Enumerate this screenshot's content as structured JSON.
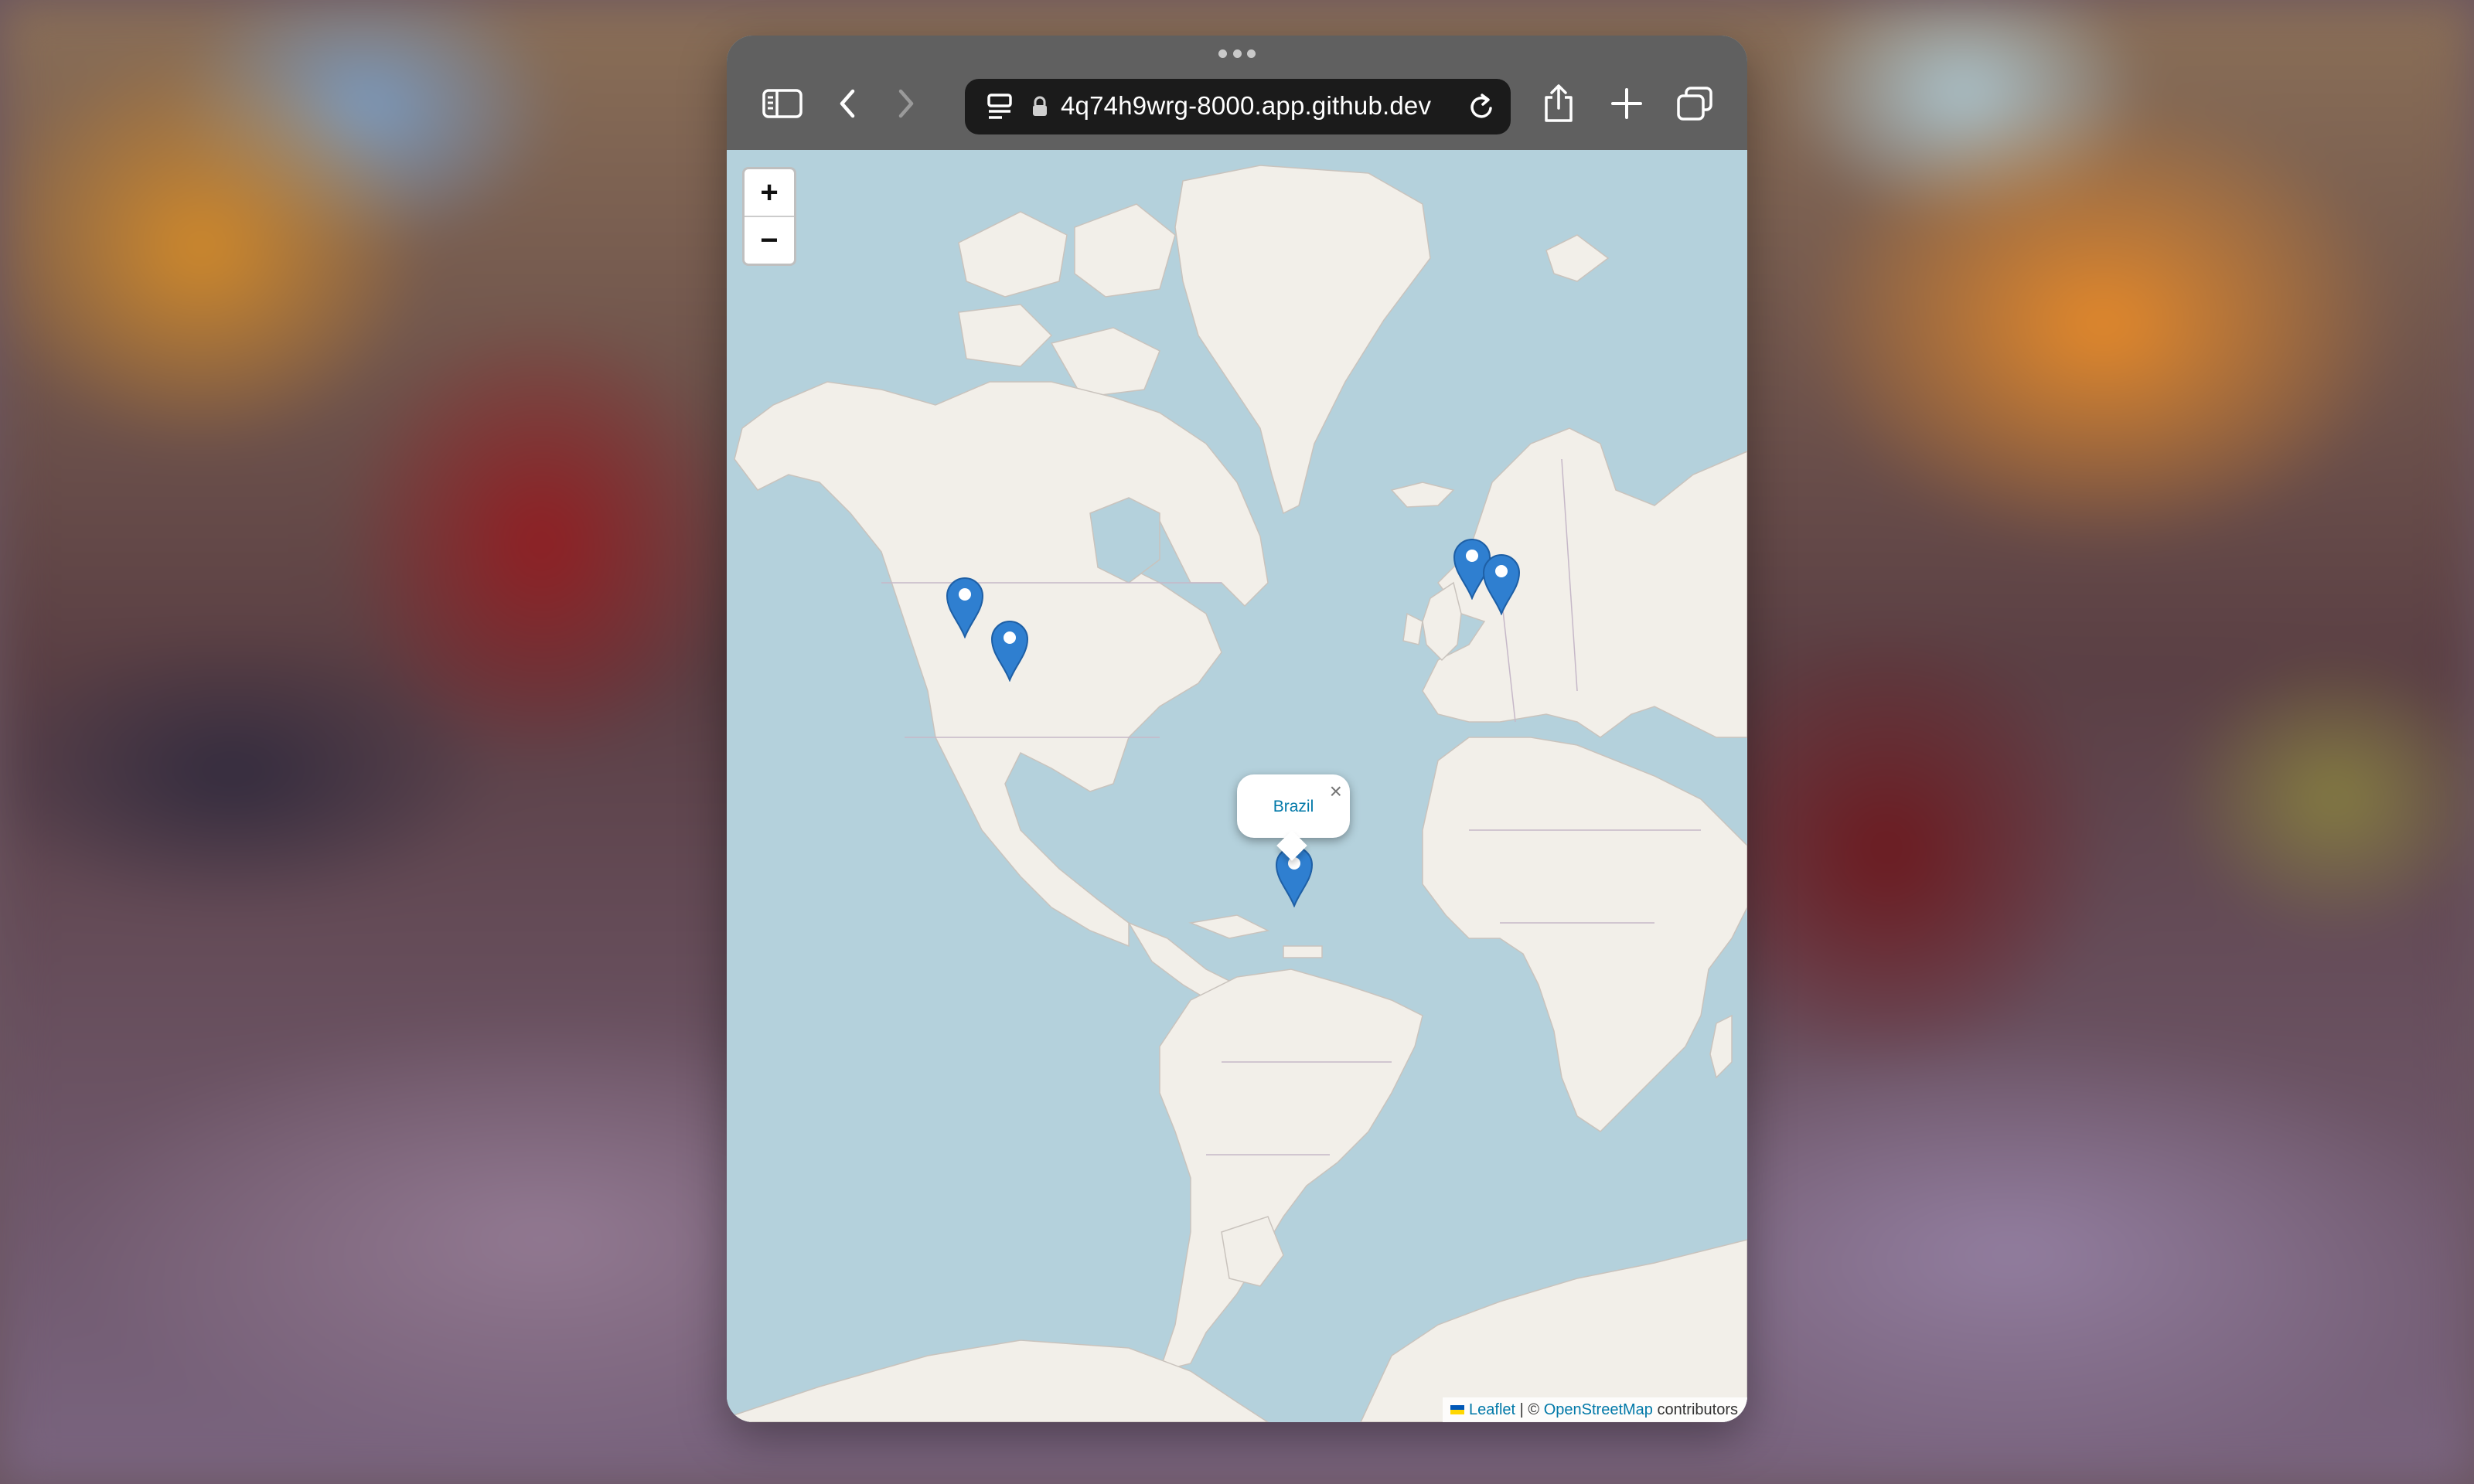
{
  "browser": {
    "url": "4q74h9wrg-8000.app.github.dev",
    "icons": [
      "sidebar-icon",
      "back-icon",
      "forward-icon",
      "page-menu-icon",
      "lock-icon",
      "reload-icon",
      "share-icon",
      "new-tab-icon",
      "tabs-icon"
    ]
  },
  "map": {
    "zoom_in_label": "+",
    "zoom_out_label": "−",
    "markers": [
      "marker-seattle",
      "marker-west-usa",
      "marker-uk",
      "marker-netherlands",
      "marker-brazil"
    ],
    "popup": {
      "text": "Brazil",
      "close_label": "×"
    },
    "attribution": {
      "leaflet": "Leaflet",
      "separator": "| ©",
      "osm": "OpenStreetMap",
      "suffix": "contributors"
    }
  },
  "colors": {
    "ocean": "#b4d1dc",
    "land": "#f2efe9",
    "marker": "#2f7fd0",
    "link": "#0078a8",
    "toolbar": "#606060"
  }
}
